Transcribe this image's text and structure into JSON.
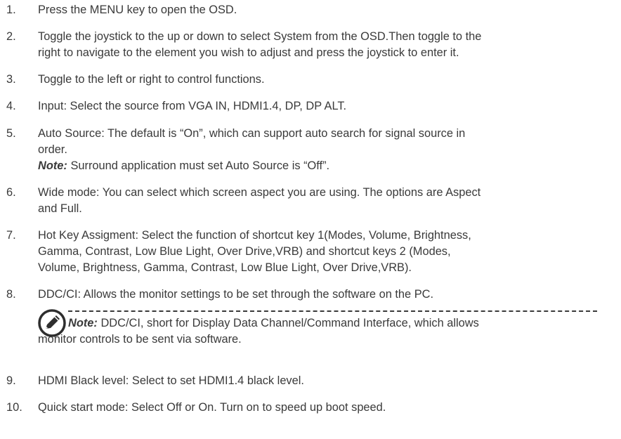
{
  "steps": [
    {
      "num": "1.",
      "text": "Press the MENU key to open the OSD."
    },
    {
      "num": "2.",
      "line1": "Toggle the joystick to the up or down to select System from the OSD.Then toggle to the",
      "line2": "right to navigate to the element you wish to adjust and press the joystick to enter it."
    },
    {
      "num": "3.",
      "text": "Toggle to the left or right to control functions."
    },
    {
      "num": "4.",
      "text": "Input: Select the source from VGA IN, HDMI1.4, DP, DP ALT."
    },
    {
      "num": "5.",
      "line1": "Auto Source: The default is “On”, which can support auto search for signal source in",
      "line2": "order.",
      "note_label": "Note:",
      "note_text": " Surround application must set Auto Source is “Off”."
    },
    {
      "num": "6.",
      "line1": "Wide mode: You can select which screen aspect you are using. The options are Aspect",
      "line2": "and Full."
    },
    {
      "num": "7.",
      "line1": "Hot Key Assigment: Select the function of shortcut key 1(Modes, Volume, Brightness,",
      "line2": "Gamma, Contrast, Low Blue Light, Over Drive,VRB) and shortcut keys 2 (Modes,",
      "line3": "Volume, Brightness, Gamma, Contrast, Low Blue Light, Over Drive,VRB)."
    },
    {
      "num": "8.",
      "text": "DDC/CI: Allows the monitor settings to be set through the software on the PC.",
      "note_label": "Note:",
      "note_line1": " DDC/CI, short for Display Data Channel/Command Interface, which allows",
      "note_line2": "monitor controls to be sent via software."
    },
    {
      "num": "9.",
      "text": "HDMI Black level: Select to set HDMI1.4 black level."
    },
    {
      "num": "10.",
      "text": "Quick start mode: Select Off or On. Turn on to speed up boot speed."
    }
  ],
  "icons": {
    "note": "note-pencil-icon"
  },
  "colors": {
    "text": "#3a3a3a"
  }
}
